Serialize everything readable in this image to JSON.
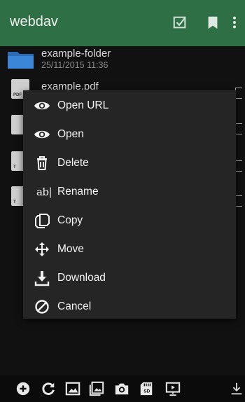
{
  "appbar": {
    "title": "webdav",
    "accent": "#2e6f45"
  },
  "files": [
    {
      "name": "example-folder",
      "date": "25/11/2015 11:36",
      "kind": "folder"
    },
    {
      "name": "example.pdf",
      "kind": "pdf"
    }
  ],
  "context_menu": {
    "items": [
      {
        "label": "Open URL",
        "icon": "eye-icon"
      },
      {
        "label": "Open",
        "icon": "eye-icon"
      },
      {
        "label": "Delete",
        "icon": "trash-icon"
      },
      {
        "label": "Rename",
        "icon": "rename-icon",
        "icon_text": "ab|"
      },
      {
        "label": "Copy",
        "icon": "copy-icon"
      },
      {
        "label": "Move",
        "icon": "move-icon"
      },
      {
        "label": "Download",
        "icon": "download-icon"
      },
      {
        "label": "Cancel",
        "icon": "cancel-icon"
      }
    ]
  },
  "bottom_bar": {
    "icons": [
      "add-icon",
      "refresh-icon",
      "image-icon",
      "gallery-icon",
      "camera-icon",
      "sd-card-icon",
      "screen-icon",
      "download-icon"
    ],
    "sd_label": "SD"
  }
}
